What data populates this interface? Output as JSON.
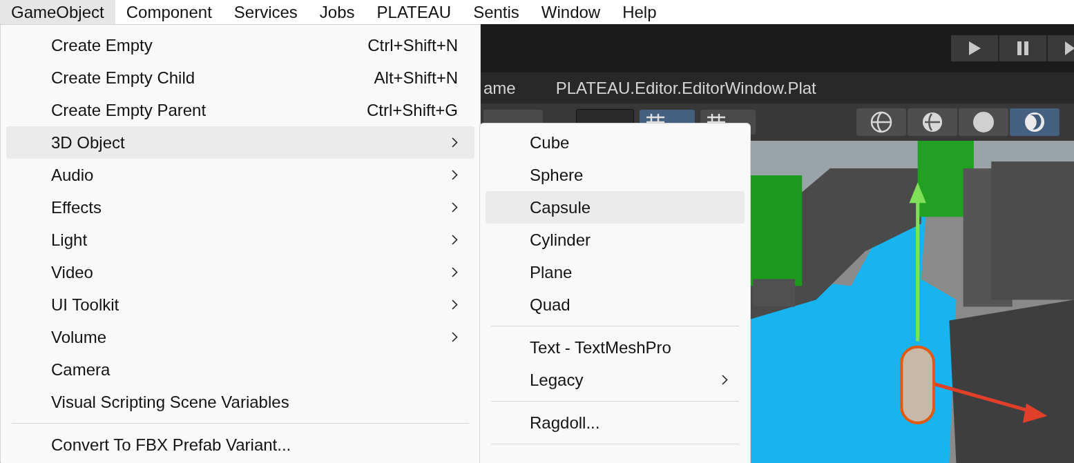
{
  "menu_bar": [
    {
      "label": "GameObject",
      "selected": true
    },
    {
      "label": "Component",
      "selected": false
    },
    {
      "label": "Services",
      "selected": false
    },
    {
      "label": "Jobs",
      "selected": false
    },
    {
      "label": "PLATEAU",
      "selected": false
    },
    {
      "label": "Sentis",
      "selected": false
    },
    {
      "label": "Window",
      "selected": false
    },
    {
      "label": "Help",
      "selected": false
    }
  ],
  "editor": {
    "tabs": [
      {
        "label": "ame"
      },
      {
        "label": "PLATEAU.Editor.EditorWindow.Plat"
      }
    ],
    "grid_buttons": [
      {
        "selected": true
      },
      {
        "selected": false
      }
    ],
    "shading_modes": [
      {
        "selected": false
      },
      {
        "selected": false
      },
      {
        "selected": false
      },
      {
        "selected": true
      }
    ]
  },
  "menu": [
    {
      "kind": "shortcut",
      "label": "Create Empty",
      "shortcut": "Ctrl+Shift+N",
      "selected": false
    },
    {
      "kind": "shortcut",
      "label": "Create Empty Child",
      "shortcut": "Alt+Shift+N",
      "selected": false
    },
    {
      "kind": "shortcut",
      "label": "Create Empty Parent",
      "shortcut": "Ctrl+Shift+G",
      "selected": false
    },
    {
      "kind": "submenu",
      "label": "3D Object",
      "selected": true
    },
    {
      "kind": "submenu",
      "label": "Audio",
      "selected": false
    },
    {
      "kind": "submenu",
      "label": "Effects",
      "selected": false
    },
    {
      "kind": "submenu",
      "label": "Light",
      "selected": false
    },
    {
      "kind": "submenu",
      "label": "Video",
      "selected": false
    },
    {
      "kind": "submenu",
      "label": "UI Toolkit",
      "selected": false
    },
    {
      "kind": "submenu",
      "label": "Volume",
      "selected": false
    },
    {
      "kind": "plain",
      "label": "Camera",
      "selected": false
    },
    {
      "kind": "plain",
      "label": "Visual Scripting Scene Variables",
      "selected": false
    },
    {
      "kind": "separator"
    },
    {
      "kind": "plain",
      "label": "Convert To FBX Prefab Variant...",
      "selected": false
    }
  ],
  "submenu": [
    {
      "kind": "plain",
      "label": "Cube",
      "selected": false
    },
    {
      "kind": "plain",
      "label": "Sphere",
      "selected": false
    },
    {
      "kind": "plain",
      "label": "Capsule",
      "selected": true
    },
    {
      "kind": "plain",
      "label": "Cylinder",
      "selected": false
    },
    {
      "kind": "plain",
      "label": "Plane",
      "selected": false
    },
    {
      "kind": "plain",
      "label": "Quad",
      "selected": false
    },
    {
      "kind": "separator"
    },
    {
      "kind": "plain",
      "label": "Text - TextMeshPro",
      "selected": false
    },
    {
      "kind": "submenu",
      "label": "Legacy",
      "selected": false
    },
    {
      "kind": "separator"
    },
    {
      "kind": "plain",
      "label": "Ragdoll...",
      "selected": false
    },
    {
      "kind": "separator"
    }
  ]
}
